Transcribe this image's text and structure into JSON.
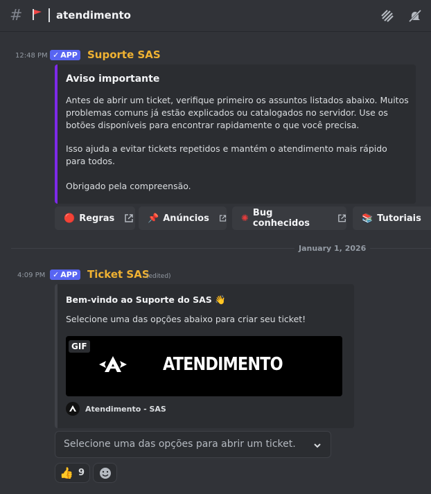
{
  "header": {
    "channel_name": "atendimento"
  },
  "messages": [
    {
      "timestamp": "12:48 PM",
      "app_badge": "APP",
      "author": "Suporte SAS",
      "embed": {
        "title": "Aviso importante",
        "paragraphs": [
          "Antes de abrir um ticket, verifique primeiro os assuntos listados abaixo. Muitos problemas comuns já estão explicados ou catalogados no servidor. Use os botões disponíveis para encontrar rapidamente o que você precisa.",
          "Isso ajuda a evitar tickets repetidos e mantém o atendimento mais rápido para todos.",
          "Obrigado pela compreensão."
        ]
      },
      "buttons": [
        {
          "label": "Regras"
        },
        {
          "label": "Anúncios"
        },
        {
          "label": "Bug conhecidos"
        },
        {
          "label": "Tutoriais"
        }
      ]
    },
    {
      "timestamp": "4:09 PM",
      "app_badge": "APP",
      "author": "Ticket SAS",
      "edited": "(edited)",
      "embed": {
        "title": "Bem-vindo ao Suporte do SAS 👋",
        "text": "Selecione uma das opções abaixo para criar seu ticket!",
        "gif_badge": "GIF",
        "gif_text": "ATENDIMENTO",
        "footer": "Atendimento - SAS"
      },
      "select_placeholder": "Selecione uma das opções para abrir um ticket.",
      "reactions": [
        {
          "emoji": "👍",
          "count": "9"
        }
      ]
    }
  ],
  "date_divider": "January 1, 2026",
  "colors": {
    "accent": "#f0b232",
    "app_badge": "#5865f2",
    "embed1_border": "#7d2ae8"
  }
}
